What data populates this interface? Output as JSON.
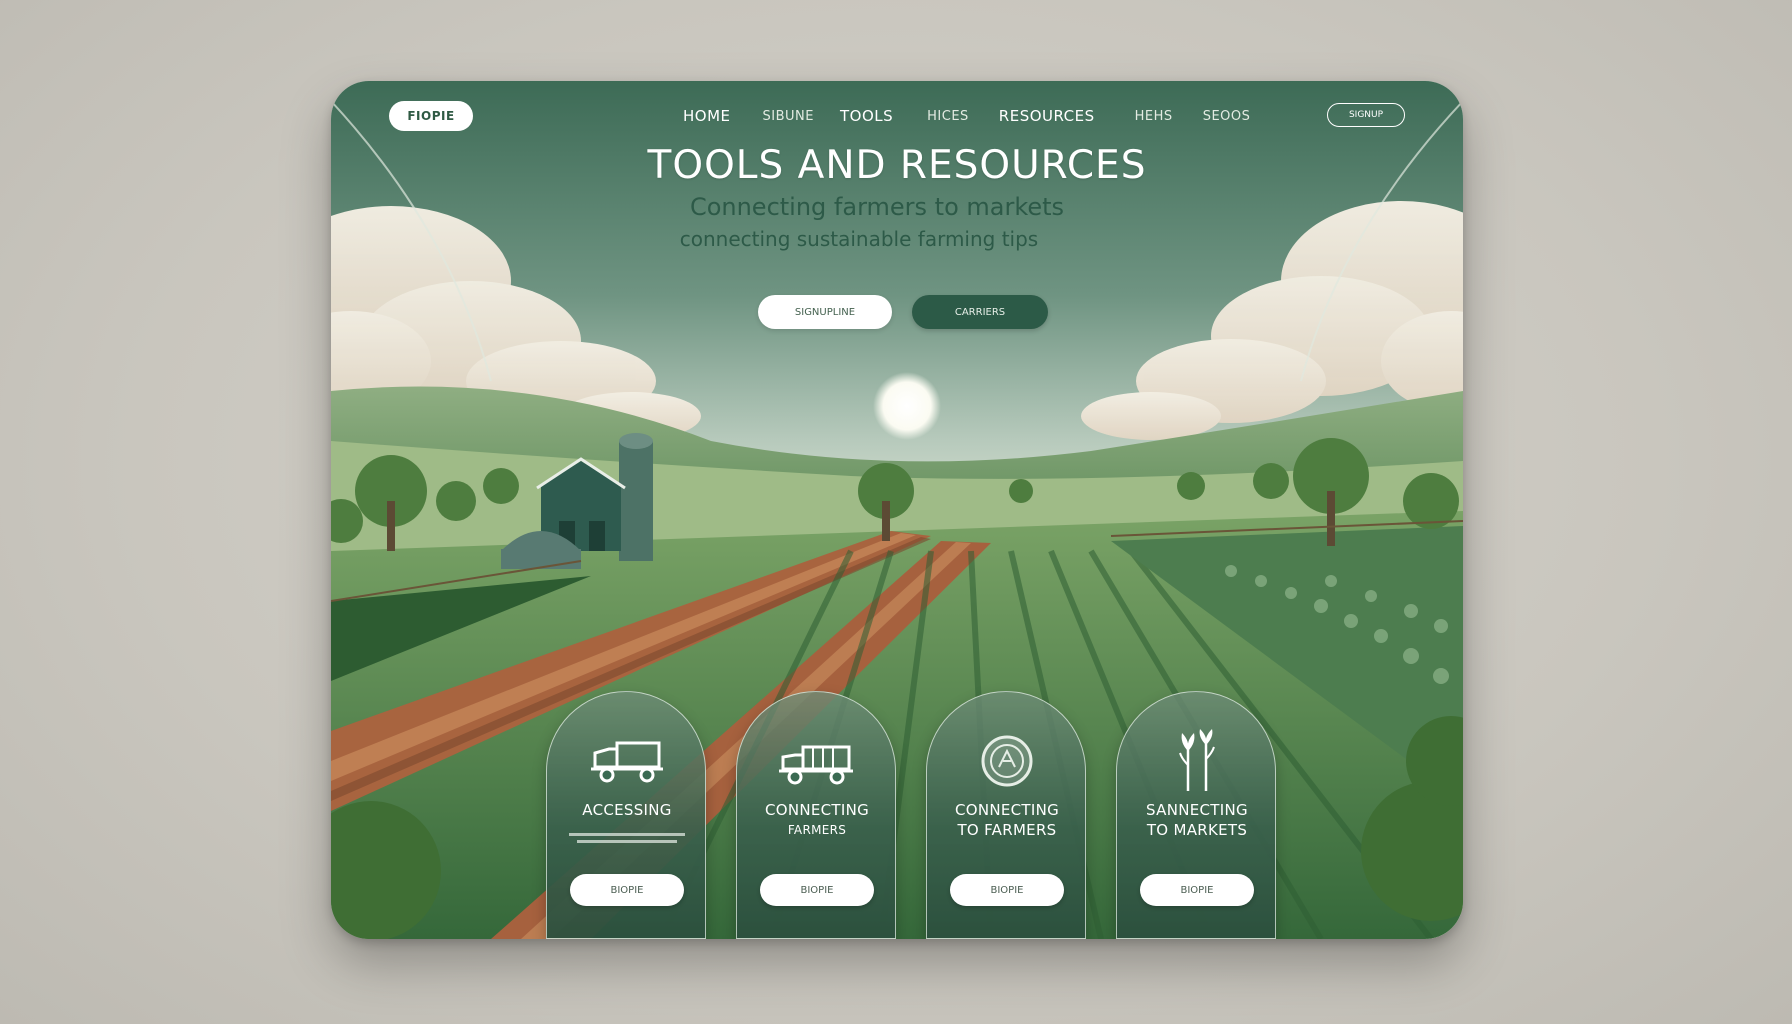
{
  "header": {
    "logo": "FIOPIE",
    "nav": [
      {
        "label": "HOME",
        "muted": false
      },
      {
        "label": "SIBUNE",
        "muted": true
      },
      {
        "label": "TOOLS",
        "muted": false
      },
      {
        "label": "HICES",
        "muted": true
      },
      {
        "label": "RESOURCES",
        "muted": false
      },
      {
        "label": "HEHS",
        "muted": true
      },
      {
        "label": "SEOOS",
        "muted": true
      }
    ],
    "signup_label": "SIGNUP"
  },
  "hero": {
    "title": "TOOLS AND RESOURCES",
    "subtitle_line1": "Connecting farmers to markets",
    "subtitle_line2": "connecting sustainable farming tips",
    "primary_button": "SIGNUPLINE",
    "secondary_button": "CARRIERS"
  },
  "cards": [
    {
      "icon": "truck-icon",
      "title_lines": [
        "ACCESSING"
      ],
      "button": "BIOPIE"
    },
    {
      "icon": "cargo-truck-icon",
      "title_lines": [
        "CONNECTING",
        "FARMERS"
      ],
      "button": "BIOPIE"
    },
    {
      "icon": "globe-badge-icon",
      "title_lines": [
        "CONNECTING",
        "TO FARMERS"
      ],
      "button": "BIOPIE"
    },
    {
      "icon": "wheat-icon",
      "title_lines": [
        "SANNECTING",
        "TO MARKETS"
      ],
      "button": "BIOPIE"
    }
  ],
  "colors": {
    "primary_green": "#2c5a47",
    "sky_top": "#3f6b57",
    "accent_white": "#ffffff"
  }
}
